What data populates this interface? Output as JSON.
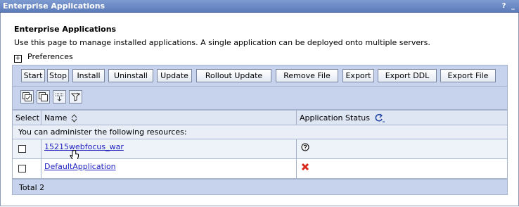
{
  "window": {
    "title": "Enterprise Applications",
    "help_label": "?",
    "close_label": "_"
  },
  "page": {
    "heading": "Enterprise Applications",
    "description": "Use this page to manage installed applications. A single application can be deployed onto multiple servers.",
    "preferences_label": "Preferences",
    "preferences_expander": "+"
  },
  "toolbar": {
    "buttons": [
      "Start",
      "Stop",
      "Install",
      "Uninstall",
      "Update",
      "Rollout Update",
      "Remove File",
      "Export",
      "Export DDL",
      "Export File"
    ]
  },
  "icon_toolbar": {
    "icons": [
      "select-all-icon",
      "deselect-all-icon",
      "show-filter-icon",
      "clear-filter-icon"
    ]
  },
  "table": {
    "columns": [
      "Select",
      "Name",
      "Application Status"
    ],
    "info_row": "You can administer the following resources:",
    "rows": [
      {
        "name": "15215webfocus_war",
        "status_icon": "unknown-status-icon"
      },
      {
        "name": "DefaultApplication",
        "status_icon": "stopped-status-icon"
      }
    ],
    "total_label": "Total 2"
  },
  "colors": {
    "titlebar": "#5c7bb8",
    "toolbar": "#c7d3ec",
    "link": "#2020c0",
    "stopped": "#d9261c"
  }
}
